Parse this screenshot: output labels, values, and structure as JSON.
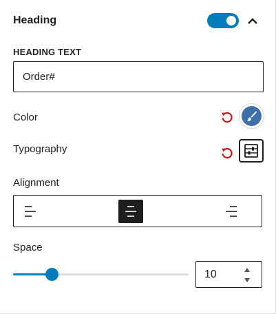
{
  "panel": {
    "title": "Heading",
    "enabled": true,
    "accent_color": "#007cba"
  },
  "heading_text": {
    "label": "HEADING TEXT",
    "value": "Order#"
  },
  "color": {
    "label": "Color",
    "swatch_color": "#3e6fa8",
    "reset_icon": "reset-icon",
    "picker_icon": "brush-icon"
  },
  "typography": {
    "label": "Typography",
    "reset_icon": "reset-icon",
    "settings_icon": "sliders-icon"
  },
  "alignment": {
    "label": "Alignment",
    "options": [
      "left",
      "center",
      "right"
    ],
    "selected": "center"
  },
  "space": {
    "label": "Space",
    "value": "10",
    "slider_fraction": 0.22
  }
}
